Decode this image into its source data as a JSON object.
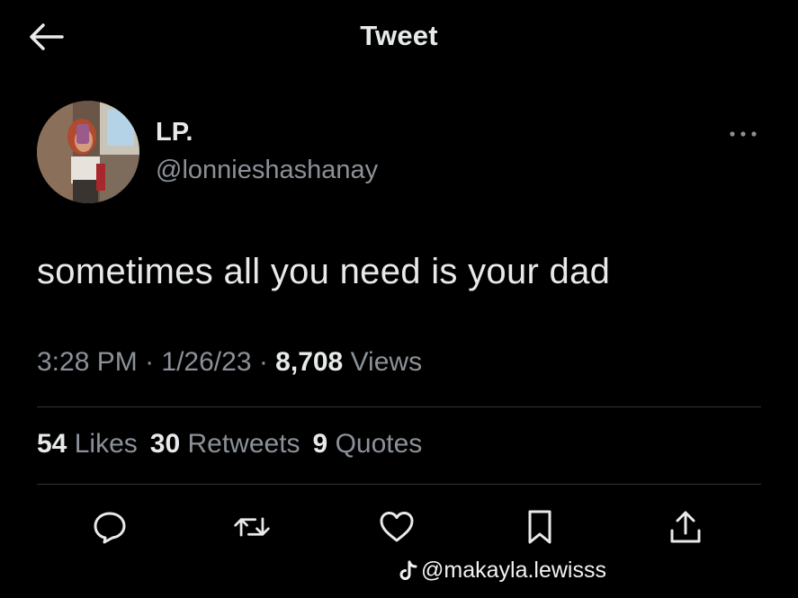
{
  "header": {
    "title": "Tweet",
    "back_icon": "arrow-left-icon"
  },
  "author": {
    "display_name": "LP.",
    "handle": "@lonnieshashanay",
    "more_icon": "more-horizontal-icon"
  },
  "tweet": {
    "text": "sometimes all you need is your dad",
    "time": "3:28 PM",
    "sep1": " · ",
    "date": "1/26/23",
    "sep2": " · ",
    "views_count": "8,708",
    "views_label": " Views"
  },
  "stats": {
    "likes_count": "54",
    "likes_label": "Likes",
    "retweets_count": "30",
    "retweets_label": "Retweets",
    "quotes_count": "9",
    "quotes_label": "Quotes"
  },
  "actions": [
    {
      "name": "reply",
      "icon": "reply-icon"
    },
    {
      "name": "retweet",
      "icon": "retweet-icon"
    },
    {
      "name": "like",
      "icon": "heart-icon"
    },
    {
      "name": "bookmark",
      "icon": "bookmark-icon"
    },
    {
      "name": "share",
      "icon": "share-icon"
    }
  ],
  "watermark": {
    "text": "@makayla.lewisss",
    "icon": "tiktok-icon"
  },
  "colors": {
    "background": "#000000",
    "primary_text": "#e7e9ea",
    "secondary_text": "#8b9198",
    "divider": "#2f3336"
  }
}
